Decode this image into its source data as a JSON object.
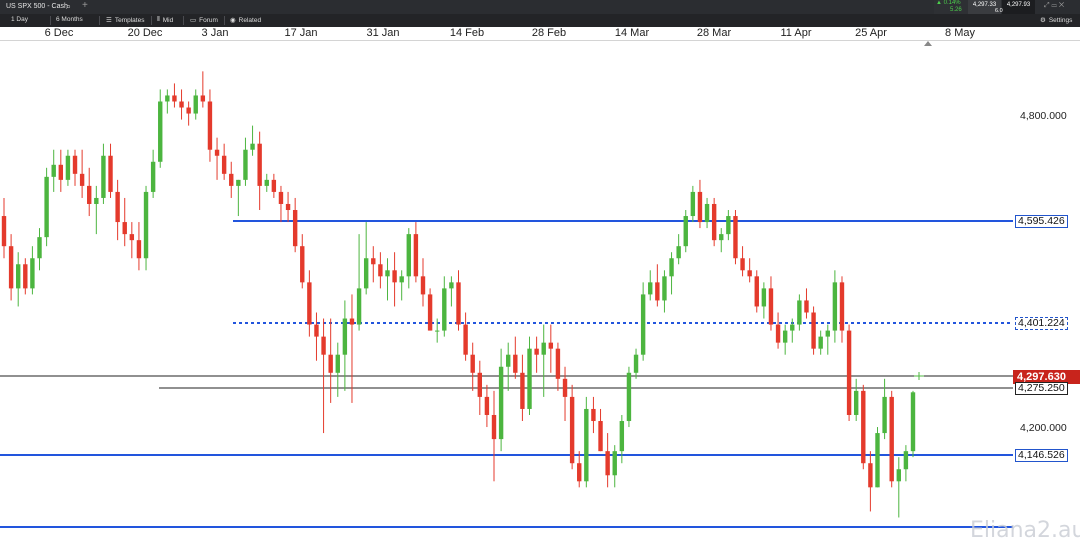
{
  "window": {
    "title": "US SPX 500 - Cash"
  },
  "quotes": {
    "change_pct": "▲ 0.14%",
    "change_pts": "5.26",
    "sell": "4,297.33",
    "buy": "4,297.93",
    "spread": "6.0"
  },
  "toolbar": {
    "interval": "1 Day",
    "range": "6 Months",
    "templates": "Templates",
    "price_type": "Mid",
    "forum": "Forum",
    "related": "Related",
    "settings": "Settings"
  },
  "time_axis": [
    "6 Dec",
    "20 Dec",
    "3 Jan",
    "17 Jan",
    "31 Jan",
    "14 Feb",
    "28 Feb",
    "14 Mar",
    "28 Mar",
    "11 Apr",
    "25 Apr",
    "8 May"
  ],
  "price_axis": [
    "4,800.000",
    "4,200.000"
  ],
  "levels": {
    "r1": "4,595.426",
    "r2": "4,401.224",
    "current": "4,297.630",
    "pivot": "4,275.250",
    "s1": "4,146.526"
  },
  "watermark": "Eliana2.au",
  "colors": {
    "bull": "#4cb53f",
    "bear": "#e43a2c",
    "level_line": "#2255dd",
    "current_badge": "#c8241c"
  },
  "chart_data": {
    "type": "candlestick",
    "ylim": [
      4046,
      4882
    ],
    "y_ticks": [
      4200,
      4800
    ],
    "ohlc": [
      [
        4590,
        4620,
        4520,
        4540
      ],
      [
        4540,
        4560,
        4450,
        4470
      ],
      [
        4470,
        4530,
        4440,
        4510
      ],
      [
        4510,
        4520,
        4460,
        4470
      ],
      [
        4470,
        4540,
        4460,
        4520
      ],
      [
        4520,
        4570,
        4500,
        4555
      ],
      [
        4555,
        4670,
        4540,
        4655
      ],
      [
        4655,
        4700,
        4630,
        4675
      ],
      [
        4675,
        4700,
        4630,
        4650
      ],
      [
        4650,
        4700,
        4640,
        4690
      ],
      [
        4690,
        4700,
        4640,
        4660
      ],
      [
        4660,
        4700,
        4620,
        4640
      ],
      [
        4640,
        4670,
        4590,
        4610
      ],
      [
        4610,
        4640,
        4560,
        4620
      ],
      [
        4620,
        4710,
        4610,
        4690
      ],
      [
        4690,
        4710,
        4620,
        4630
      ],
      [
        4630,
        4650,
        4550,
        4580
      ],
      [
        4580,
        4620,
        4540,
        4560
      ],
      [
        4560,
        4580,
        4520,
        4550
      ],
      [
        4550,
        4580,
        4500,
        4520
      ],
      [
        4520,
        4640,
        4500,
        4630
      ],
      [
        4630,
        4700,
        4620,
        4680
      ],
      [
        4680,
        4800,
        4670,
        4780
      ],
      [
        4780,
        4800,
        4760,
        4790
      ],
      [
        4790,
        4810,
        4770,
        4780
      ],
      [
        4780,
        4800,
        4750,
        4770
      ],
      [
        4770,
        4780,
        4740,
        4760
      ],
      [
        4760,
        4800,
        4750,
        4790
      ],
      [
        4790,
        4830,
        4770,
        4780
      ],
      [
        4780,
        4800,
        4680,
        4700
      ],
      [
        4700,
        4720,
        4650,
        4690
      ],
      [
        4690,
        4710,
        4650,
        4660
      ],
      [
        4660,
        4680,
        4620,
        4640
      ],
      [
        4640,
        4650,
        4590,
        4650
      ],
      [
        4650,
        4720,
        4640,
        4700
      ],
      [
        4700,
        4740,
        4690,
        4710
      ],
      [
        4710,
        4730,
        4600,
        4640
      ],
      [
        4640,
        4660,
        4630,
        4650
      ],
      [
        4650,
        4660,
        4620,
        4630
      ],
      [
        4630,
        4640,
        4580,
        4610
      ],
      [
        4610,
        4630,
        4580,
        4600
      ],
      [
        4600,
        4620,
        4530,
        4540
      ],
      [
        4540,
        4560,
        4470,
        4480
      ],
      [
        4480,
        4500,
        4390,
        4410
      ],
      [
        4410,
        4430,
        4350,
        4390
      ],
      [
        4390,
        4420,
        4230,
        4360
      ],
      [
        4360,
        4420,
        4280,
        4330
      ],
      [
        4330,
        4380,
        4290,
        4360
      ],
      [
        4360,
        4450,
        4300,
        4420
      ],
      [
        4420,
        4460,
        4280,
        4410
      ],
      [
        4410,
        4560,
        4400,
        4470
      ],
      [
        4470,
        4580,
        4460,
        4520
      ],
      [
        4520,
        4540,
        4480,
        4510
      ],
      [
        4510,
        4530,
        4470,
        4490
      ],
      [
        4490,
        4520,
        4450,
        4500
      ],
      [
        4500,
        4530,
        4440,
        4480
      ],
      [
        4480,
        4500,
        4450,
        4490
      ],
      [
        4490,
        4570,
        4470,
        4560
      ],
      [
        4560,
        4580,
        4480,
        4490
      ],
      [
        4490,
        4520,
        4440,
        4460
      ],
      [
        4460,
        4470,
        4400,
        4400
      ],
      [
        4400,
        4420,
        4380,
        4400
      ],
      [
        4400,
        4490,
        4390,
        4470
      ],
      [
        4470,
        4490,
        4440,
        4480
      ],
      [
        4480,
        4500,
        4400,
        4410
      ],
      [
        4410,
        4430,
        4350,
        4360
      ],
      [
        4360,
        4380,
        4300,
        4330
      ],
      [
        4330,
        4350,
        4260,
        4290
      ],
      [
        4290,
        4310,
        4240,
        4260
      ],
      [
        4260,
        4300,
        4150,
        4220
      ],
      [
        4220,
        4370,
        4200,
        4340
      ],
      [
        4340,
        4380,
        4300,
        4360
      ],
      [
        4360,
        4390,
        4320,
        4330
      ],
      [
        4330,
        4360,
        4250,
        4270
      ],
      [
        4270,
        4390,
        4260,
        4370
      ],
      [
        4370,
        4390,
        4330,
        4360
      ],
      [
        4360,
        4410,
        4290,
        4380
      ],
      [
        4380,
        4410,
        4330,
        4370
      ],
      [
        4370,
        4380,
        4300,
        4320
      ],
      [
        4320,
        4340,
        4250,
        4290
      ],
      [
        4290,
        4310,
        4170,
        4180
      ],
      [
        4180,
        4200,
        4140,
        4150
      ],
      [
        4150,
        4290,
        4140,
        4270
      ],
      [
        4270,
        4290,
        4230,
        4250
      ],
      [
        4250,
        4270,
        4200,
        4200
      ],
      [
        4200,
        4230,
        4140,
        4160
      ],
      [
        4160,
        4210,
        4140,
        4200
      ],
      [
        4200,
        4260,
        4180,
        4250
      ],
      [
        4250,
        4340,
        4240,
        4330
      ],
      [
        4330,
        4370,
        4320,
        4360
      ],
      [
        4360,
        4480,
        4350,
        4460
      ],
      [
        4460,
        4500,
        4450,
        4480
      ],
      [
        4480,
        4510,
        4440,
        4450
      ],
      [
        4450,
        4500,
        4430,
        4490
      ],
      [
        4490,
        4530,
        4460,
        4520
      ],
      [
        4520,
        4560,
        4510,
        4540
      ],
      [
        4540,
        4600,
        4530,
        4590
      ],
      [
        4590,
        4640,
        4580,
        4630
      ],
      [
        4630,
        4650,
        4570,
        4580
      ],
      [
        4580,
        4620,
        4570,
        4610
      ],
      [
        4610,
        4620,
        4540,
        4550
      ],
      [
        4550,
        4570,
        4530,
        4560
      ],
      [
        4560,
        4600,
        4550,
        4590
      ],
      [
        4590,
        4600,
        4510,
        4520
      ],
      [
        4520,
        4540,
        4490,
        4500
      ],
      [
        4500,
        4520,
        4480,
        4490
      ],
      [
        4490,
        4500,
        4430,
        4440
      ],
      [
        4440,
        4480,
        4420,
        4470
      ],
      [
        4470,
        4490,
        4400,
        4410
      ],
      [
        4410,
        4430,
        4370,
        4380
      ],
      [
        4380,
        4410,
        4360,
        4400
      ],
      [
        4400,
        4420,
        4380,
        4410
      ],
      [
        4410,
        4460,
        4400,
        4450
      ],
      [
        4450,
        4470,
        4420,
        4430
      ],
      [
        4430,
        4440,
        4360,
        4370
      ],
      [
        4370,
        4400,
        4360,
        4390
      ],
      [
        4390,
        4410,
        4360,
        4400
      ],
      [
        4400,
        4500,
        4380,
        4480
      ],
      [
        4480,
        4490,
        4380,
        4400
      ],
      [
        4400,
        4410,
        4250,
        4260
      ],
      [
        4260,
        4320,
        4250,
        4300
      ],
      [
        4300,
        4310,
        4170,
        4180
      ],
      [
        4180,
        4200,
        4100,
        4140
      ],
      [
        4140,
        4240,
        4140,
        4230
      ],
      [
        4230,
        4320,
        4220,
        4290
      ],
      [
        4290,
        4300,
        4140,
        4150
      ],
      [
        4150,
        4190,
        4090,
        4170
      ],
      [
        4170,
        4210,
        4150,
        4200
      ],
      [
        4200,
        4300,
        4190,
        4297.63
      ]
    ]
  }
}
